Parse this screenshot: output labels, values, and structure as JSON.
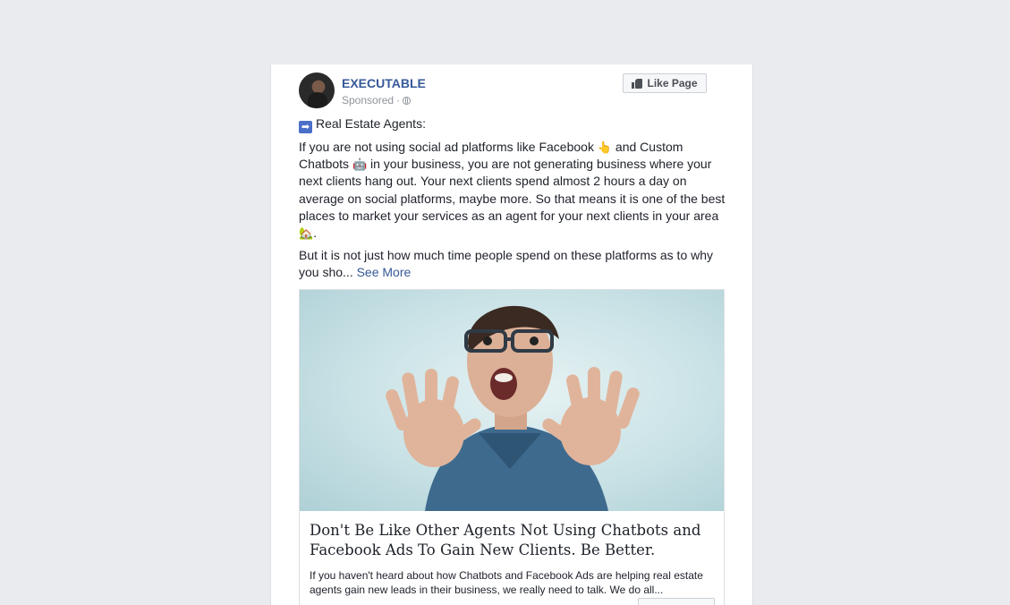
{
  "post": {
    "page_name": "EXECUTABLE",
    "sponsored_label": "Sponsored",
    "separator": "·",
    "like_page_label": "Like Page",
    "intro_line": "Real Estate Agents:",
    "paragraph1_a": "If you are not using social ad platforms like Facebook",
    "paragraph1_emoji1": "👆",
    "paragraph1_b": "and Custom Chatbots",
    "paragraph1_emoji2": "🤖",
    "paragraph1_c": "in your business, you are not generating business where your next clients hang out. Your next clients spend almost 2 hours a day on average on social platforms, maybe more. So that means it is one of the best places to market your services as an agent for your next clients in your area",
    "paragraph1_emoji3": "🏡",
    "paragraph1_end": ".",
    "paragraph2": "But it is not just how much time people spend on these platforms as to why you sho...",
    "see_more": "See More"
  },
  "link_preview": {
    "headline": "Don't Be Like Other Agents Not Using Chatbots and Facebook Ads To Gain New Clients. Be Better.",
    "description": "If you haven't heard about how Chatbots and Facebook Ads are helping real estate agents gain new leads in their business, we really need to talk. We do all..."
  },
  "icons": [
    "avatar",
    "globe-icon",
    "thumb-icon",
    "arrow-right-icon"
  ],
  "colors": {
    "page_bg": "#e9ebee",
    "link": "#365899",
    "text": "#1d2129",
    "meta": "#90949c"
  }
}
